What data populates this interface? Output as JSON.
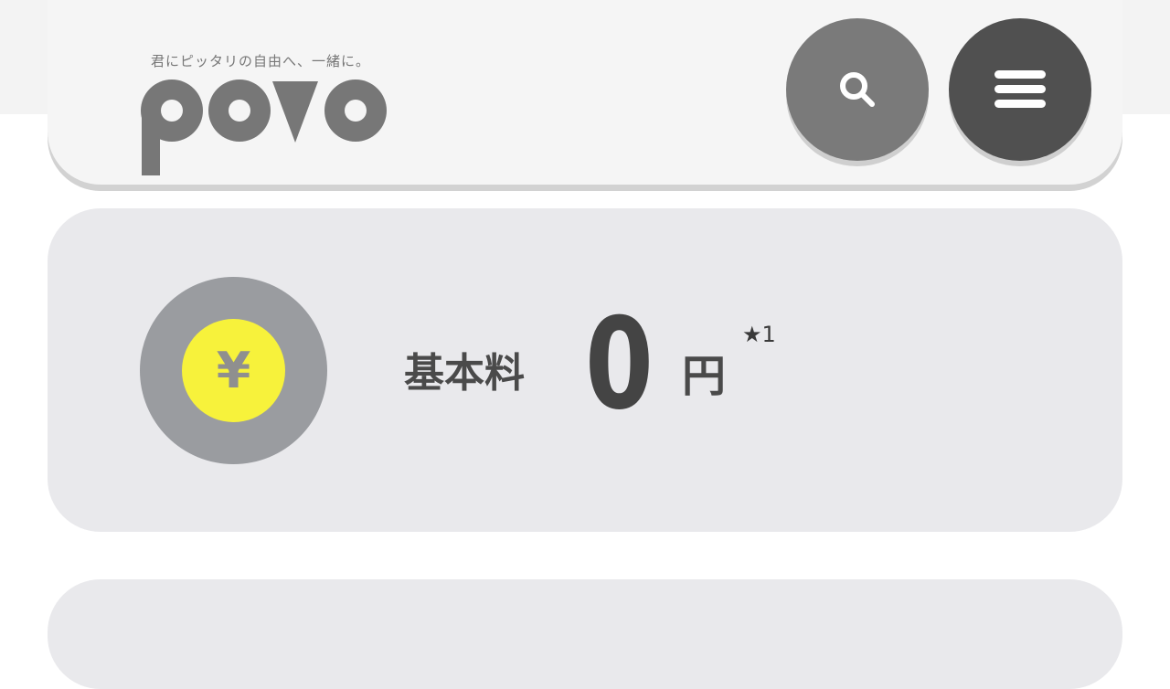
{
  "header": {
    "tagline": "君にピッタリの自由へ、一緒に。",
    "logo_text": "povo"
  },
  "search_button": {
    "icon": "search-icon"
  },
  "menu_button": {
    "icon": "hamburger-menu-icon"
  },
  "feature": {
    "icon": "yen-coin-icon",
    "icon_symbol": "¥",
    "label": "基本料",
    "value": "0",
    "unit": "円",
    "footnote": "★1"
  },
  "colors": {
    "header_bg": "#f5f5f5",
    "card_bg": "#e9e9ec",
    "search_button": "#7a7a7a",
    "menu_button": "#505050",
    "coin_outer": "#9a9ca0",
    "coin_inner": "#f7f23b",
    "logo": "#777777"
  }
}
